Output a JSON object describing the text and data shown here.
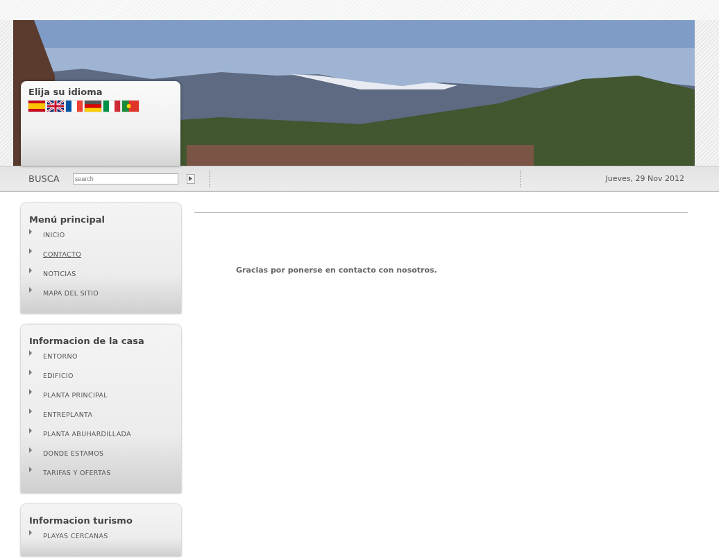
{
  "language_box": {
    "title": "Elija su idioma",
    "flags": [
      {
        "kind": "es"
      },
      {
        "kind": "gb"
      },
      {
        "kind": "fr"
      },
      {
        "kind": "de"
      },
      {
        "kind": "it"
      },
      {
        "kind": "pt"
      }
    ]
  },
  "search_bar": {
    "label": "BUSCA",
    "placeholder": "search",
    "date": "Jueves, 29 Nov 2012"
  },
  "sidebar": [
    {
      "title": "Menú principal",
      "items": [
        {
          "label": "INICIO",
          "selected": false
        },
        {
          "label": "CONTACTO",
          "selected": true
        },
        {
          "label": "NOTICIAS",
          "selected": false
        },
        {
          "label": "MAPA DEL SITIO",
          "selected": false
        }
      ]
    },
    {
      "title": "Informacion de la casa",
      "items": [
        {
          "label": "ENTORNO",
          "selected": false
        },
        {
          "label": "EDIFICIO",
          "selected": false
        },
        {
          "label": "PLANTA PRINCIPAL",
          "selected": false
        },
        {
          "label": "ENTREPLANTA",
          "selected": false
        },
        {
          "label": "PLANTA ABUHARDILLADA",
          "selected": false
        },
        {
          "label": "DONDE ESTAMOS",
          "selected": false
        },
        {
          "label": "TARIFAS Y OFERTAS",
          "selected": false
        }
      ]
    },
    {
      "title": "Informacion turismo",
      "items": [
        {
          "label": "PLAYAS CERCANAS",
          "selected": false
        }
      ]
    }
  ],
  "content": {
    "message": "Gracias por ponerse en contacto con nosotros."
  }
}
